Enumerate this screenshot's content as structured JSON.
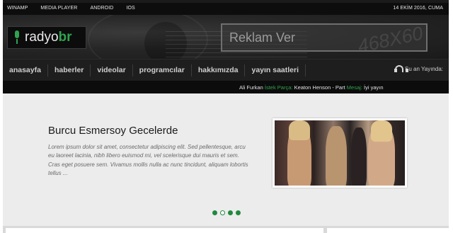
{
  "topbar": {
    "links": [
      "WINAMP",
      "MEDIA PLAYER",
      "ANDROID",
      "IOS"
    ],
    "date": "14 EKİM 2016, CUMA"
  },
  "logo": {
    "part1": "radyo",
    "part2": "br"
  },
  "ad": {
    "label": "Reklam Ver",
    "size": "468X60"
  },
  "nav": {
    "items": [
      "anasayfa",
      "haberler",
      "videolar",
      "programcılar",
      "hakkımızda",
      "yayın saatleri"
    ],
    "onair": "Şu an Yayında:"
  },
  "ticker": {
    "name": "Ali Furkan",
    "request_label": "İstek Parça:",
    "request_value": "Keaton Henson - Part",
    "message_label": "Mesaj:",
    "message_value": "İyi yayın"
  },
  "slide": {
    "title": "Burcu Esmersoy Gecelerde",
    "body": "Lorem ipsum dolor sit amet, consectetur adipiscing elit. Sed pellentesque, arcu eu laoreet lacinia, nibh libero euismod mi, vel scelerisque dui mauris et sem. Cras eget posuere sem. Vivamus mollis nulla ac nunc tincidunt, aliquam lobortis tellus ..."
  },
  "dots": {
    "count": 4,
    "active": 1
  },
  "colors": {
    "accent": "#2fa34e",
    "dark": "#1b1b1b",
    "slider_bg": "#ececec"
  }
}
